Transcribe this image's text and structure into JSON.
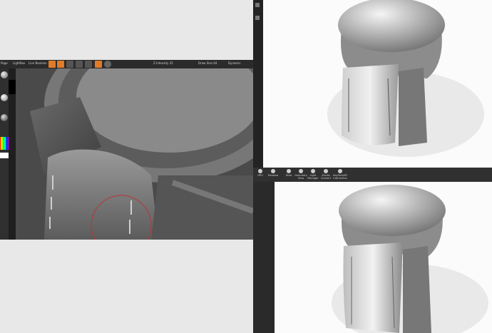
{
  "zbrush": {
    "toolbar": {
      "left_label": "Page",
      "lightbox": "LightBox",
      "live_boolean": "Live Boolean",
      "mid_label": "Z Intensity 25",
      "right_label": "Draw Size 64",
      "dynamic": "Dynamic"
    },
    "colors": {
      "accent": "#e07b2a",
      "bg": "#3a3a3a"
    }
  },
  "keyshot_top": {
    "colors": {
      "bg": "#fbfbfb",
      "sidebar": "#232323"
    }
  },
  "keyshot_bottom": {
    "toolbar": [
      {
        "icon": "gpu-icon",
        "label": "GPU"
      },
      {
        "icon": "denoise-icon",
        "label": "Denoise"
      },
      {
        "icon": "tools-icon",
        "label": "Tools"
      },
      {
        "icon": "geometry-view-icon",
        "label": "Geometry\nView"
      },
      {
        "icon": "light-manager-icon",
        "label": "Light\nManager"
      },
      {
        "icon": "studio-icon",
        "label": "Studio\nConvert"
      },
      {
        "icon": "keyshotxr-icon",
        "label": "KeyShotXR\nInteractive"
      }
    ]
  }
}
